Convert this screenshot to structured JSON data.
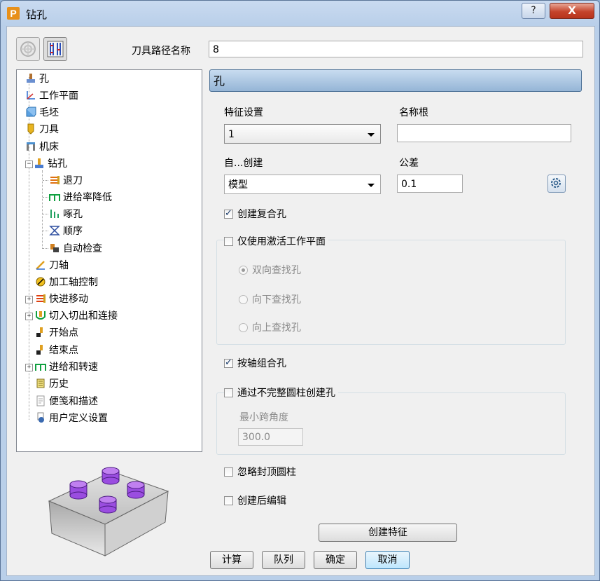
{
  "window": {
    "title": "钻孔",
    "app_icon_letter": "P",
    "help_label": "?",
    "close_label": "X"
  },
  "toolpath_name": {
    "label": "刀具路径名称",
    "value": "8"
  },
  "tree": {
    "items": [
      {
        "label": "孔",
        "icon": "hole-icon"
      },
      {
        "label": "工作平面",
        "icon": "workplane-icon"
      },
      {
        "label": "毛坯",
        "icon": "block-icon"
      },
      {
        "label": "刀具",
        "icon": "tool-icon"
      },
      {
        "label": "机床",
        "icon": "machine-icon"
      },
      {
        "label": "钻孔",
        "icon": "drilling-icon",
        "expanded": true
      },
      {
        "label": "退刀",
        "icon": "retract-icon"
      },
      {
        "label": "进给率降低",
        "icon": "feed-reduction-icon"
      },
      {
        "label": "啄孔",
        "icon": "peck-icon"
      },
      {
        "label": "顺序",
        "icon": "order-icon"
      },
      {
        "label": "自动检查",
        "icon": "auto-verify-icon"
      },
      {
        "label": "刀轴",
        "icon": "tool-axis-icon"
      },
      {
        "label": "加工轴控制",
        "icon": "axis-control-icon"
      },
      {
        "label": "快进移动",
        "icon": "rapid-move-icon",
        "expandable": true
      },
      {
        "label": "切入切出和连接",
        "icon": "leads-links-icon",
        "expandable": true
      },
      {
        "label": "开始点",
        "icon": "start-point-icon"
      },
      {
        "label": "结束点",
        "icon": "end-point-icon"
      },
      {
        "label": "进给和转速",
        "icon": "feeds-speeds-icon",
        "expandable": true
      },
      {
        "label": "历史",
        "icon": "history-icon"
      },
      {
        "label": "便笺和描述",
        "icon": "notes-icon"
      },
      {
        "label": "用户定义设置",
        "icon": "user-settings-icon"
      }
    ]
  },
  "panel": {
    "header": "孔",
    "feature_set": {
      "label": "特征设置",
      "value": "1"
    },
    "name_root": {
      "label": "名称根",
      "value": ""
    },
    "create_from": {
      "label": "自...创建",
      "value": "模型"
    },
    "tolerance": {
      "label": "公差",
      "value": "0.1"
    },
    "create_compound_holes": {
      "label": "创建复合孔",
      "checked": true
    },
    "active_workplane_only": {
      "label": "仅使用激活工作平面",
      "checked": false
    },
    "search_direction": {
      "options": [
        "双向查找孔",
        "向下查找孔",
        "向上查找孔"
      ],
      "selected": "双向查找孔"
    },
    "group_by_axis": {
      "label": "按轴组合孔",
      "checked": true
    },
    "partial_cylinders": {
      "label": "通过不完整圆柱创建孔",
      "checked": false
    },
    "min_span_angle": {
      "label": "最小跨角度",
      "value": "300.0"
    },
    "ignore_capped": {
      "label": "忽略封顶圆柱",
      "checked": false
    },
    "edit_after_create": {
      "label": "创建后编辑",
      "checked": false
    },
    "create_features_button": "创建特征"
  },
  "footer": {
    "calculate": "计算",
    "queue": "队列",
    "ok": "确定",
    "cancel": "取消"
  },
  "colors": {
    "accent": "#3c7fb1",
    "header_bg": "#a9c4e1",
    "hole_purple": "#9a4de0"
  }
}
